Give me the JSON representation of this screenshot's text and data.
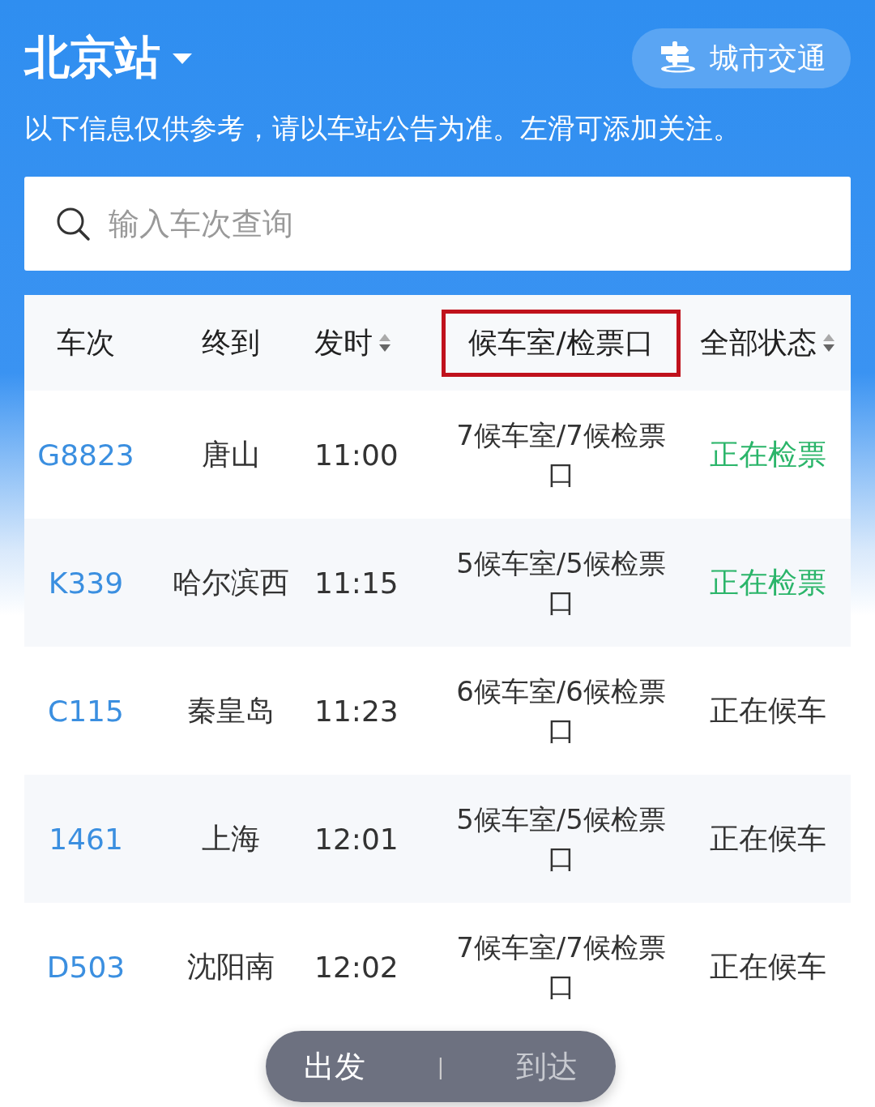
{
  "station": {
    "name": "北京站",
    "transit_button": "城市交通"
  },
  "notice": "以下信息仅供参考，请以车站公告为准。左滑可添加关注。",
  "search": {
    "placeholder": "输入车次查询"
  },
  "columns": [
    {
      "label": "车次",
      "sortable": false,
      "highlighted": false
    },
    {
      "label": "终到",
      "sortable": false,
      "highlighted": false
    },
    {
      "label": "发时",
      "sortable": true,
      "highlighted": false
    },
    {
      "label": "候车室/检票口",
      "sortable": false,
      "highlighted": true
    },
    {
      "label": "全部状态",
      "sortable": true,
      "highlighted": false
    }
  ],
  "rows": [
    {
      "train": "G8823",
      "destination": "唐山",
      "time": "11:00",
      "gate": "7候车室/7候检票口",
      "status": "正在检票",
      "kind": "checking"
    },
    {
      "train": "K339",
      "destination": "哈尔滨西",
      "time": "11:15",
      "gate": "5候车室/5候检票口",
      "status": "正在检票",
      "kind": "checking"
    },
    {
      "train": "C115",
      "destination": "秦皇岛",
      "time": "11:23",
      "gate": "6候车室/6候检票口",
      "status": "正在候车",
      "kind": "waiting"
    },
    {
      "train": "1461",
      "destination": "上海",
      "time": "12:01",
      "gate": "5候车室/5候检票口",
      "status": "正在候车",
      "kind": "waiting"
    },
    {
      "train": "D503",
      "destination": "沈阳南",
      "time": "12:02",
      "gate": "7候车室/7候检票口",
      "status": "正在候车",
      "kind": "waiting"
    }
  ],
  "toggle": {
    "separator": "|",
    "options": [
      {
        "label": "出发",
        "selected": true
      },
      {
        "label": "到达",
        "selected": false
      }
    ]
  }
}
